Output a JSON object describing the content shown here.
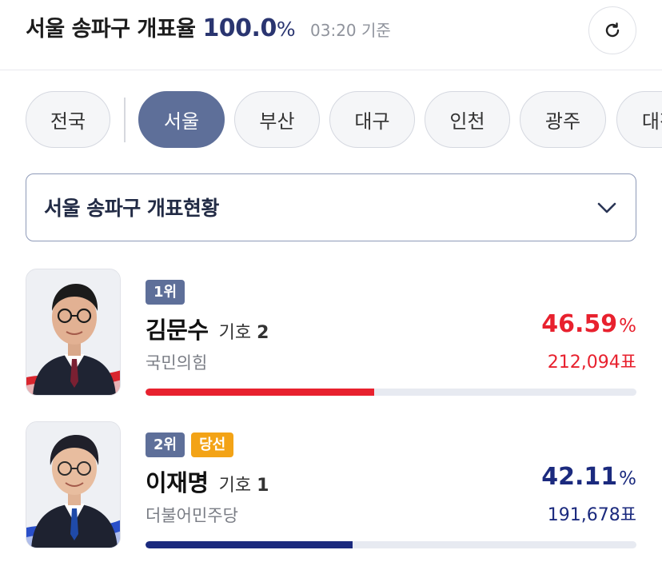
{
  "header": {
    "title": "서울 송파구 개표율",
    "rate": "100.0",
    "rate_unit": "%",
    "time": "03:20 기준",
    "refresh_icon": "refresh-icon"
  },
  "regions": {
    "items": [
      {
        "label": "전국"
      },
      {
        "label": "서울",
        "active": true
      },
      {
        "label": "부산"
      },
      {
        "label": "대구"
      },
      {
        "label": "인천"
      },
      {
        "label": "광주"
      },
      {
        "label": "대전"
      }
    ]
  },
  "dropdown": {
    "label": "서울 송파구 개표현황",
    "icon": "chevron-down-icon"
  },
  "candidates": [
    {
      "rank": "1위",
      "name": "김문수",
      "symbol_label": "기호",
      "symbol_number": "2",
      "party": "국민의힘",
      "percent": "46.59",
      "percent_unit": "%",
      "votes": "212,094표",
      "share": 46.59,
      "color": "#e8212e"
    },
    {
      "rank": "2위",
      "win_label": "당선",
      "name": "이재명",
      "symbol_label": "기호",
      "symbol_number": "1",
      "party": "더불어민주당",
      "percent": "42.11",
      "percent_unit": "%",
      "votes": "191,678표",
      "share": 42.11,
      "color": "#1b2a7e"
    }
  ],
  "colors": {
    "accent": "#5e6f99",
    "win_badge": "#f3a316",
    "rate_text": "#2a3570"
  }
}
